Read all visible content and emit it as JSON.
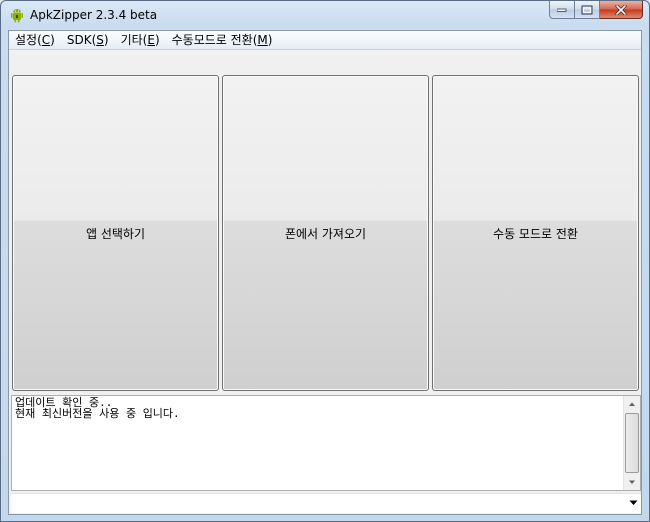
{
  "window": {
    "title": "ApkZipper 2.3.4 beta"
  },
  "menu": {
    "items": [
      {
        "label": "설정(",
        "accel": "C",
        "close": ")"
      },
      {
        "label": "SDK(",
        "accel": "S",
        "close": ")"
      },
      {
        "label": "기타(",
        "accel": "E",
        "close": ")"
      },
      {
        "label": "수동모드로 전환(",
        "accel": "M",
        "close": ")"
      }
    ]
  },
  "buttons": {
    "select_app": "앱 선택하기",
    "fetch_from_phone": "폰에서 가져오기",
    "manual_mode": "수동 모드로 전환"
  },
  "log": {
    "lines": "업데이트 확인 중..\n현재 최신버전을 사용 중 입니다."
  },
  "combo": {
    "value": ""
  },
  "colors": {
    "titlebar": "#c9dcf0",
    "close_button": "#c4391c",
    "android_green": "#8ab000"
  },
  "icons": {
    "app": "android-robot-icon",
    "minimize": "minimize-icon",
    "maximize": "maximize-icon",
    "close": "close-icon"
  }
}
